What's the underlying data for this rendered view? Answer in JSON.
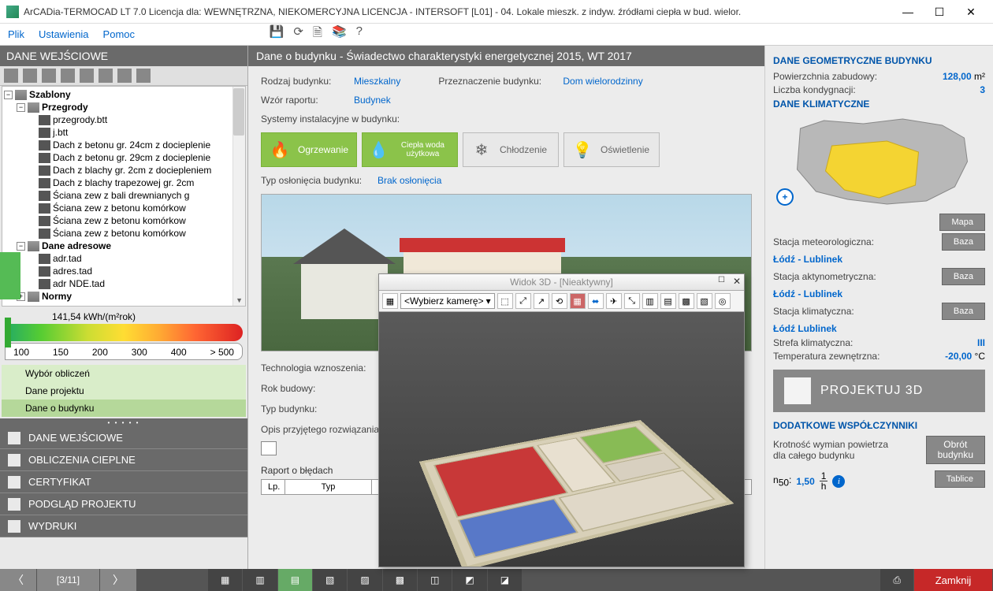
{
  "window": {
    "title": "ArCADia-TERMOCAD LT 7.0 Licencja dla: WEWNĘTRZNA, NIEKOMERCYJNA LICENCJA - INTERSOFT [L01] - 04. Lokale mieszk. z indyw. źródłami ciepła w bud. wielor.",
    "min": "—",
    "max": "☐",
    "close": "✕"
  },
  "menu": {
    "file": "Plik",
    "settings": "Ustawienia",
    "help": "Pomoc"
  },
  "left": {
    "header": "DANE WEJŚCIOWE",
    "tree": {
      "root": "Szablony",
      "grp1": "Przegrody",
      "items1": [
        "przegrody.btt",
        "j.btt",
        "Dach z betonu gr. 24cm z docieplenie",
        "Dach z betonu gr. 29cm z docieplenie",
        "Dach z blachy gr. 2cm z dociepleniem",
        "Dach z blachy trapezowej gr. 2cm",
        "Ściana zew z bali drewnianych g",
        "Ściana zew z betonu komórkow",
        "Ściana zew z betonu komórkow",
        "Ściana zew z betonu komórkow"
      ],
      "grp2": "Dane adresowe",
      "items2": [
        "adr.tad",
        "adres.tad",
        "adr NDE.tad"
      ],
      "grp3": "Normy"
    },
    "gauge": {
      "value": "141,54 kWh/(m²rok)",
      "ticks": [
        "100",
        "150",
        "200",
        "300",
        "400",
        "> 500"
      ]
    },
    "selections": {
      "a": "Wybór obliczeń",
      "b": "Dane projektu",
      "c": "Dane o budynku"
    },
    "nav": [
      "DANE WEJŚCIOWE",
      "OBLICZENIA CIEPLNE",
      "CERTYFIKAT",
      "PODGLĄD PROJEKTU",
      "WYDRUKI"
    ]
  },
  "center": {
    "header": "Dane o budynku - Świadectwo charakterystyki energetycznej 2015, WT 2017",
    "rodzaj_l": "Rodzaj budynku:",
    "rodzaj_v": "Mieszkalny",
    "przezn_l": "Przeznaczenie budynku:",
    "przezn_v": "Dom wielorodzinny",
    "wzor_l": "Wzór raportu:",
    "wzor_v": "Budynek",
    "sys_l": "Systemy instalacyjne w budynku:",
    "sys": {
      "heat": "Ogrzewanie",
      "hot": "Ciepła woda użytkowa",
      "cool": "Chłodzenie",
      "light": "Oświetlenie"
    },
    "oslon_l": "Typ osłonięcia budynku:",
    "oslon_v": "Brak osłonięcia",
    "tech_l": "Technologia wznoszenia:",
    "rok_l": "Rok budowy:",
    "typ_l": "Typ budynku:",
    "opis_l": "Opis przyjętego rozwiązania:",
    "err_l": "Raport o błędach",
    "err_cols": {
      "lp": "Lp.",
      "typ": "Typ"
    }
  },
  "right": {
    "geo_title": "DANE GEOMETRYCZNE BUDYNKU",
    "pow_l": "Powierzchnia zabudowy:",
    "pow_v": "128,00",
    "pow_u": "m²",
    "kond_l": "Liczba kondygnacji:",
    "kond_v": "3",
    "klim_title": "DANE KLIMATYCZNE",
    "mapa_btn": "Mapa",
    "meteo_l": "Stacja meteorologiczna:",
    "meteo_v": "Łódź - Lublinek",
    "baza_btn": "Baza",
    "aktyn_l": "Stacja aktynometryczna:",
    "aktyn_v": "Łódź - Lublinek",
    "sklim_l": "Stacja klimatyczna:",
    "sklim_v": "Łódź Lublinek",
    "strefa_l": "Strefa klimatyczna:",
    "strefa_v": "III",
    "temp_l": "Temperatura zewnętrzna:",
    "temp_v": "-20,00",
    "temp_u": "°C",
    "proj3d": "PROJEKTUJ 3D",
    "dod_title": "DODATKOWE WSPÓŁCZYNNIKI",
    "krot_l": "Krotność wymian powietrza dla całego budynku",
    "obrot_btn1": "Obrót",
    "obrot_btn2": "budynku",
    "n50_l": "n",
    "n50_sub": "50",
    "n50_v": "1,50",
    "tablice_btn": "Tablice"
  },
  "widok": {
    "title": "Widok 3D - [Nieaktywny]",
    "camera": "<Wybierz kamerę>"
  },
  "footer": {
    "page": "[3/11]",
    "close": "Zamknij"
  }
}
